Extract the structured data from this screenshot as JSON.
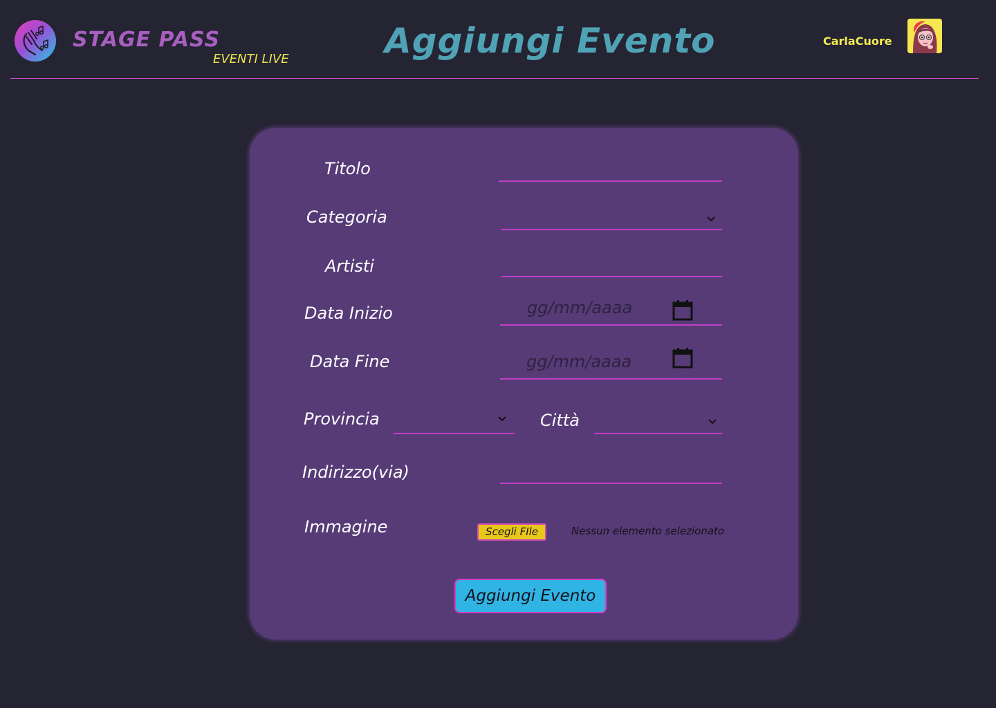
{
  "header": {
    "brand": "STAGE PASS",
    "tagline": "EVENTI LIVE",
    "title": "Aggiungi Evento",
    "username": "CarlaCuore",
    "logo_icon": "music-hand-icon",
    "avatar_icon": "user-avatar"
  },
  "colors": {
    "background": "#252433",
    "card": "#573b77",
    "accent_line": "#c13fc6",
    "brand": "#a85fc0",
    "tagline": "#e6e34d",
    "title": "#4fa3b5",
    "username": "#f3ee52",
    "submit_bg": "#2fb4e3",
    "file_btn_bg": "#e8c818"
  },
  "form": {
    "titolo_label": "Titolo",
    "categoria_label": "Categoria",
    "artisti_label": "Artisti",
    "data_inizio_label": "Data Inizio",
    "data_inizio_placeholder": "gg/mm/aaaa",
    "data_fine_label": "Data Fine",
    "data_fine_placeholder": "gg/mm/aaaa",
    "provincia_label": "Provincia",
    "citta_label": "Città",
    "indirizzo_label": "Indirizzo(via)",
    "immagine_label": "Immagine",
    "file_button": "Scegli FIle",
    "file_status": "Nessun elemento selezionato",
    "submit": "Aggiungi Evento"
  }
}
